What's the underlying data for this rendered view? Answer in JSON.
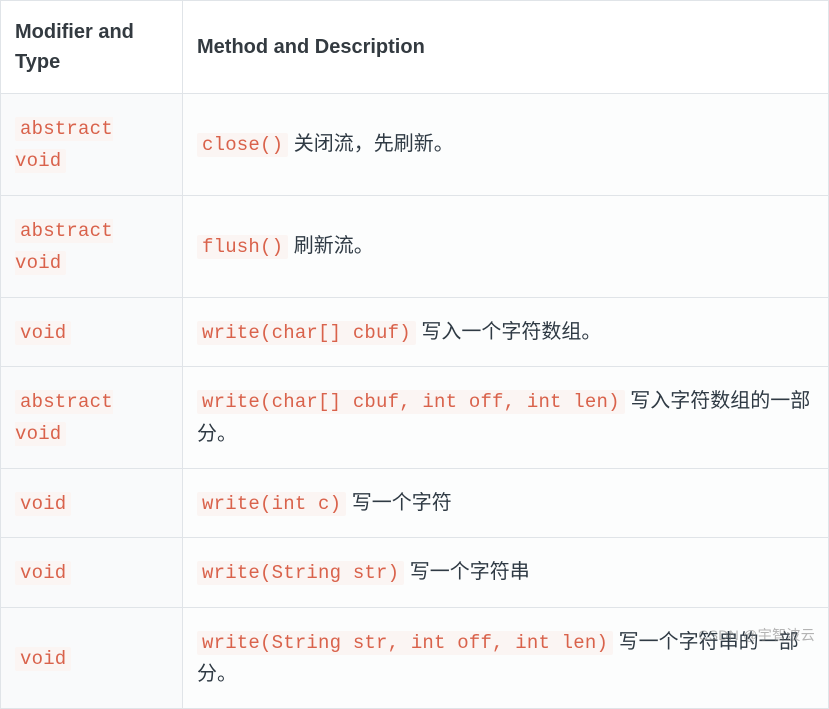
{
  "headers": {
    "modifier": "Modifier and Type",
    "method": "Method and Description"
  },
  "rows": [
    {
      "modifier": "abstract void",
      "method": "close()",
      "description": "关闭流，先刷新。"
    },
    {
      "modifier": "abstract void",
      "method": "flush()",
      "description": "刷新流。"
    },
    {
      "modifier": "void",
      "method": "write(char[] cbuf)",
      "description": "写入一个字符数组。"
    },
    {
      "modifier": "abstract void",
      "method": "write(char[] cbuf, int off, int len)",
      "description": "写入字符数组的一部分。"
    },
    {
      "modifier": "void",
      "method": "write(int c)",
      "description": "写一个字符"
    },
    {
      "modifier": "void",
      "method": "write(String str)",
      "description": "写一个字符串"
    },
    {
      "modifier": "void",
      "method": "write(String str, int off, int len)",
      "description": "写一个字符串的一部分。"
    }
  ],
  "watermark": "CSDN @宇智波云"
}
